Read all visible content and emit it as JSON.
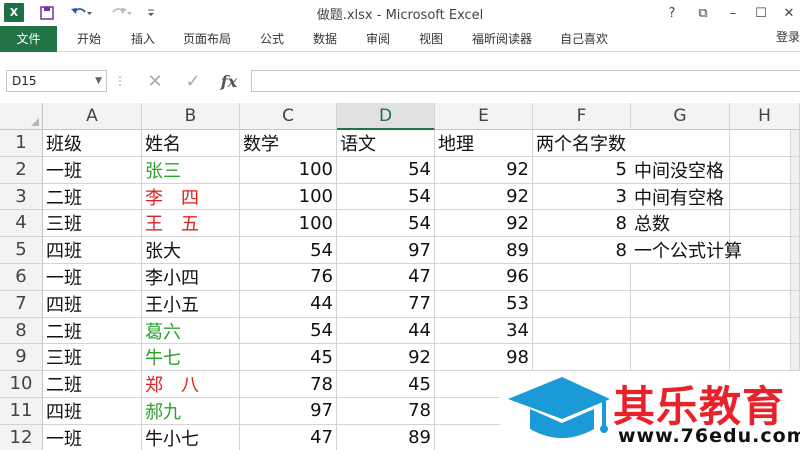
{
  "window": {
    "title": "做题.xlsx - Microsoft Excel",
    "help": "?",
    "controls": [
      "⧉",
      "–",
      "☐",
      "✕"
    ]
  },
  "ribbon": {
    "tabs": [
      "文件",
      "开始",
      "插入",
      "页面布局",
      "公式",
      "数据",
      "审阅",
      "视图",
      "福昕阅读器",
      "自己喜欢"
    ],
    "login": "登录"
  },
  "formula_bar": {
    "name_box": "D15",
    "formula": ""
  },
  "columns": [
    "A",
    "B",
    "C",
    "D",
    "E",
    "F",
    "G",
    "H"
  ],
  "selected_column": "D",
  "rows": [
    "1",
    "2",
    "3",
    "4",
    "5",
    "6",
    "7",
    "8",
    "9",
    "10",
    "11",
    "12"
  ],
  "sheet": {
    "header": [
      "班级",
      "姓名",
      "数学",
      "语文",
      "地理",
      "两个名字数"
    ],
    "data": [
      {
        "cls": "一班",
        "name": "张三",
        "name_color": "green",
        "math": "100",
        "chinese": "54",
        "geo": "92",
        "f": "5",
        "g": "中间没空格"
      },
      {
        "cls": "二班",
        "name": "李　四",
        "name_color": "red",
        "math": "100",
        "chinese": "54",
        "geo": "92",
        "f": "3",
        "g": "中间有空格"
      },
      {
        "cls": "三班",
        "name": "王　五",
        "name_color": "red",
        "math": "100",
        "chinese": "54",
        "geo": "92",
        "f": "8",
        "g": "总数"
      },
      {
        "cls": "四班",
        "name": "张大",
        "name_color": "black",
        "math": "54",
        "chinese": "97",
        "geo": "89",
        "f": "8",
        "g": "一个公式计算"
      },
      {
        "cls": "一班",
        "name": "李小四",
        "name_color": "black",
        "math": "76",
        "chinese": "47",
        "geo": "96",
        "f": "",
        "g": ""
      },
      {
        "cls": "四班",
        "name": "王小五",
        "name_color": "black",
        "math": "44",
        "chinese": "77",
        "geo": "53",
        "f": "",
        "g": ""
      },
      {
        "cls": "二班",
        "name": "葛六",
        "name_color": "green",
        "math": "54",
        "chinese": "44",
        "geo": "34",
        "f": "",
        "g": ""
      },
      {
        "cls": "三班",
        "name": "牛七",
        "name_color": "green",
        "math": "45",
        "chinese": "92",
        "geo": "98",
        "f": "",
        "g": ""
      },
      {
        "cls": "二班",
        "name": "郑　八",
        "name_color": "red",
        "math": "78",
        "chinese": "45",
        "geo": "",
        "f": "",
        "g": ""
      },
      {
        "cls": "四班",
        "name": "郝九",
        "name_color": "green",
        "math": "97",
        "chinese": "78",
        "geo": "",
        "f": "",
        "g": ""
      },
      {
        "cls": "一班",
        "name": "牛小七",
        "name_color": "black",
        "math": "47",
        "chinese": "89",
        "geo": "",
        "f": "",
        "g": ""
      }
    ]
  },
  "watermark": {
    "title": "其乐教育",
    "url": "www.76edu.com",
    "colors": {
      "brand_red": "#e8222b",
      "cap_blue": "#1a9ad6"
    }
  },
  "colors": {
    "excel_green": "#217346",
    "name_green": "#2ca02c",
    "name_red": "#e02020"
  }
}
